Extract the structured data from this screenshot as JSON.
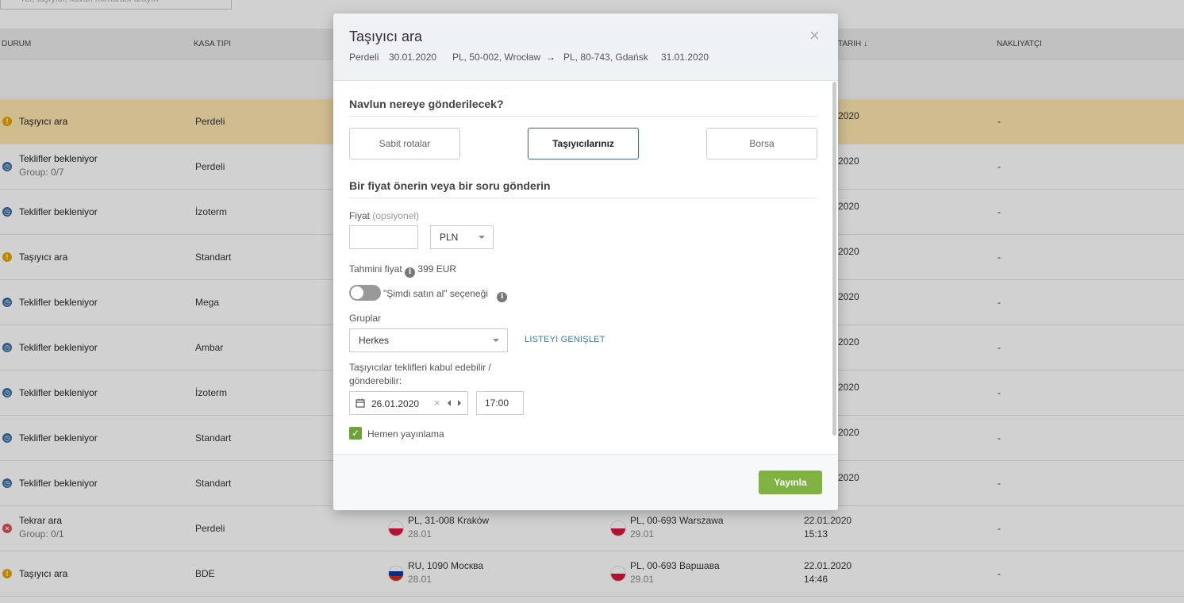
{
  "search": {
    "placeholder": "Yer, taşıyıcı, kavan numarası arayın"
  },
  "columns": {
    "durum": "DURUM",
    "kasa": "KASA TIPI",
    "tarih_partial": "TARIH ↓",
    "nakliyatci": "NAKLIYATÇI"
  },
  "rows": [
    {
      "status": "Taşıyıcı ara",
      "sub": "",
      "kasa": "Perdeli",
      "date": "2020",
      "nak": "-",
      "icon": "warning-icon",
      "highlight": true
    },
    {
      "status": "Teklifler bekleniyor",
      "sub": "Group: 0/7",
      "kasa": "Perdeli",
      "date": "2020",
      "nak": "-",
      "icon": "clock-icon"
    },
    {
      "status": "Teklifler bekleniyor",
      "sub": "",
      "kasa": "İzoterm",
      "date": "2020",
      "nak": "-",
      "icon": "clock-icon"
    },
    {
      "status": "Taşıyıcı ara",
      "sub": "",
      "kasa": "Standart",
      "date": "2020",
      "nak": "-",
      "icon": "warning-icon"
    },
    {
      "status": "Teklifler bekleniyor",
      "sub": "",
      "kasa": "Mega",
      "date": "2020",
      "nak": "-",
      "icon": "clock-icon"
    },
    {
      "status": "Teklifler bekleniyor",
      "sub": "",
      "kasa": "Ambar",
      "date": "2020",
      "nak": "-",
      "icon": "clock-icon"
    },
    {
      "status": "Teklifler bekleniyor",
      "sub": "",
      "kasa": "İzoterm",
      "date": "2020",
      "nak": "-",
      "icon": "clock-icon"
    },
    {
      "status": "Teklifler bekleniyor",
      "sub": "",
      "kasa": "Standart",
      "date": "2020",
      "nak": "-",
      "icon": "clock-icon"
    },
    {
      "status": "Teklifler bekleniyor",
      "sub": "",
      "kasa": "Standart",
      "date": "2020",
      "nak": "-",
      "icon": "clock-icon"
    },
    {
      "status": "Tekrar ara",
      "sub": "Group: 0/1",
      "kasa": "Perdeli",
      "from": "PL, 31-008 Kraków",
      "from_date": "28.01",
      "from_flag": "pl",
      "to": "PL, 00-693 Warszawa",
      "to_date": "29.01",
      "to_flag": "pl",
      "dt1": "22.01.2020",
      "dt2": "15:13",
      "nak": "-",
      "icon": "error-icon"
    },
    {
      "status": "Taşıyıcı ara",
      "sub": "",
      "kasa": "BDE",
      "from": "RU, 1090 Москва",
      "from_date": "28.01",
      "from_flag": "ru",
      "to": "PL, 00-693 Варшава",
      "to_date": "29.01",
      "to_flag": "pl",
      "dt1": "22.01.2020",
      "dt2": "14:46",
      "nak": "-",
      "icon": "warning-icon"
    }
  ],
  "modal": {
    "title": "Taşıyıcı ara",
    "close": "×",
    "summary": {
      "body": "Perdeli",
      "load_date": "30.01.2020",
      "from": "PL, 50-002, Wrocław",
      "arrow": "→",
      "to": "PL, 80-743, Gdańsk",
      "unload_date": "31.01.2020"
    },
    "section1": "Navlun nereye gönderilecek?",
    "options": [
      "Sabit rotalar",
      "Taşıyıcılarınız",
      "Borsa"
    ],
    "section2": "Bir fiyat önerin veya bir soru gönderin",
    "price_label": "Fiyat",
    "price_optional": "(opsiyonel)",
    "price_value": "",
    "currency": "PLN",
    "estimate_label": "Tahmini fiyat",
    "estimate_value": "399 EUR",
    "buy_now_label": "\"Şimdi satın al\" seçeneği",
    "groups_label": "Gruplar",
    "groups_value": "Herkes",
    "expand_link": "LISTEYI GENIŞLET",
    "deadline_label": "Taşıyıcılar teklifleri kabul edebilir / gönderebilir:",
    "deadline_date": "26.01.2020",
    "deadline_time": "17:00",
    "publish_now_label": "Hemen yayınlama",
    "publish_button": "Yayınla"
  },
  "colors": {
    "accent": "#7fb241",
    "highlight_row": "#fde7b0",
    "active_border": "#4b6b82"
  }
}
